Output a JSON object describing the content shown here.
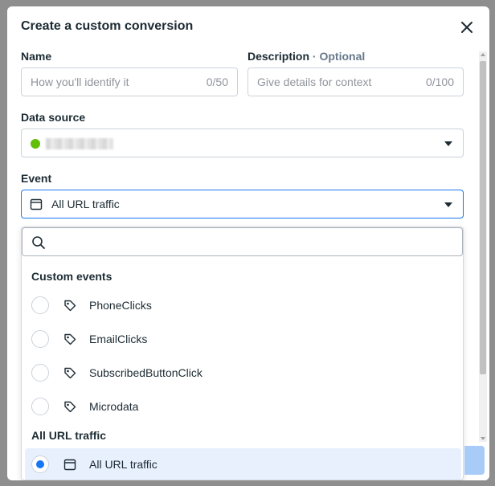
{
  "dialog": {
    "title": "Create a custom conversion",
    "close_icon": "close-icon"
  },
  "name_field": {
    "label": "Name",
    "placeholder": "How you'll identify it",
    "counter": "0/50"
  },
  "description_field": {
    "label": "Description",
    "separator": " · ",
    "optional": "Optional",
    "placeholder": "Give details for context",
    "counter": "0/100"
  },
  "data_source": {
    "label": "Data source",
    "status_color": "#63be09"
  },
  "event": {
    "label": "Event",
    "selected_value": "All URL traffic",
    "icon": "calendar-icon"
  },
  "dropdown": {
    "search_icon": "search-icon",
    "search_value": "",
    "custom_events_heading": "Custom events",
    "custom_events": [
      {
        "label": "PhoneClicks",
        "icon": "tag-icon",
        "selected": false
      },
      {
        "label": "EmailClicks",
        "icon": "tag-icon",
        "selected": false
      },
      {
        "label": "SubscribedButtonClick",
        "icon": "tag-icon",
        "selected": false
      },
      {
        "label": "Microdata",
        "icon": "tag-icon",
        "selected": false
      }
    ],
    "url_traffic_heading": "All URL traffic",
    "url_traffic_options": [
      {
        "label": "All URL traffic",
        "icon": "calendar-icon",
        "selected": true
      }
    ]
  },
  "colors": {
    "accent": "#1877f2",
    "selected_bg": "#e7f0fc",
    "text": "#1c2b33",
    "muted": "#90949c"
  }
}
